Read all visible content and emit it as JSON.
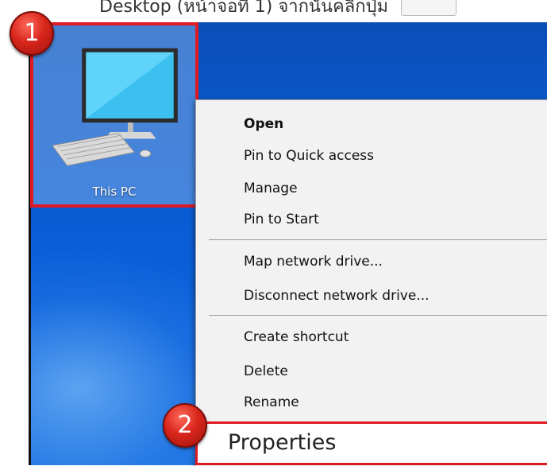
{
  "caption": {
    "text": "Desktop (หน้าจอที่ 1) จากนั้นคลิกปุ่ม"
  },
  "desktop_icon": {
    "label": "This PC"
  },
  "context_menu": {
    "items": [
      {
        "label": "Open",
        "bold": true
      },
      {
        "label": "Pin to Quick access"
      },
      {
        "label": "Manage"
      },
      {
        "label": "Pin to Start"
      },
      {
        "label": "Map network drive..."
      },
      {
        "label": "Disconnect network drive..."
      },
      {
        "label": "Create shortcut"
      },
      {
        "label": "Delete"
      },
      {
        "label": "Rename"
      },
      {
        "label": "Properties"
      }
    ]
  },
  "callouts": {
    "step1": "1",
    "step2": "2",
    "color": "#e01a22"
  },
  "colors": {
    "desktop_blue": "#0a5fd9",
    "menu_bg": "#f2f2f2"
  }
}
